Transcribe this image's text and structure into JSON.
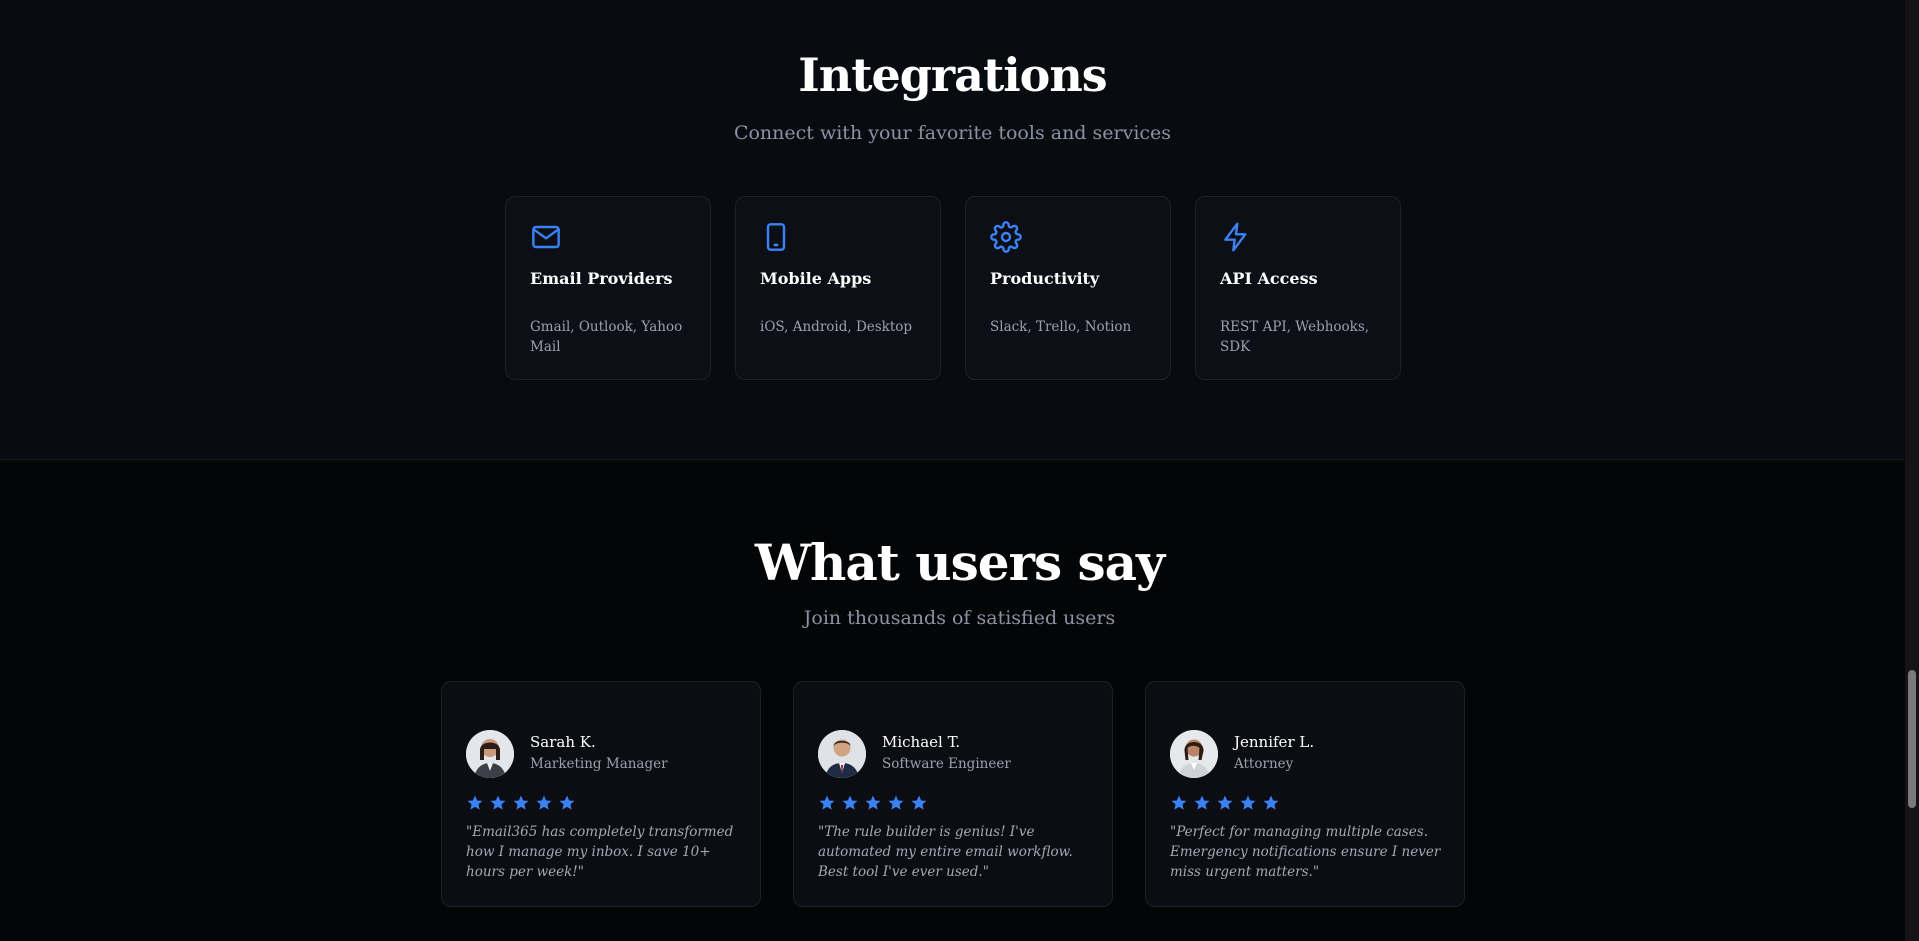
{
  "progress": {
    "fraction": 0.693,
    "color": "#3b82f6"
  },
  "integrations": {
    "title": "Integrations",
    "subtitle": "Connect with your favorite tools and services",
    "cards": [
      {
        "icon": "mail-icon",
        "title": "Email Providers",
        "description": "Gmail, Outlook, Yahoo Mail"
      },
      {
        "icon": "smartphone-icon",
        "title": "Mobile Apps",
        "description": "iOS, Android, Desktop"
      },
      {
        "icon": "gear-icon",
        "title": "Productivity",
        "description": "Slack, Trello, Notion"
      },
      {
        "icon": "lightning-icon",
        "title": "API Access",
        "description": "REST API, Webhooks, SDK"
      }
    ]
  },
  "testimonials": {
    "title": "What users say",
    "subtitle": "Join thousands of satisfied users",
    "rating_max": 5,
    "cards": [
      {
        "name": "Sarah K.",
        "role": "Marketing Manager",
        "rating": 5,
        "quote": "\"Email365 has completely transformed how I manage my inbox. I save 10+ hours per week!\""
      },
      {
        "name": "Michael T.",
        "role": "Software Engineer",
        "rating": 5,
        "quote": "\"The rule builder is genius! I've automated my entire email workflow. Best tool I've ever used.\""
      },
      {
        "name": "Jennifer L.",
        "role": "Attorney",
        "rating": 5,
        "quote": "\"Perfect for managing multiple cases. Emergency notifications ensure I never miss urgent matters.\""
      }
    ]
  },
  "colors": {
    "accent": "#3b82f6",
    "background": "#07090d",
    "card": "#0c0f15",
    "muted_text": "#9aa1ae"
  }
}
